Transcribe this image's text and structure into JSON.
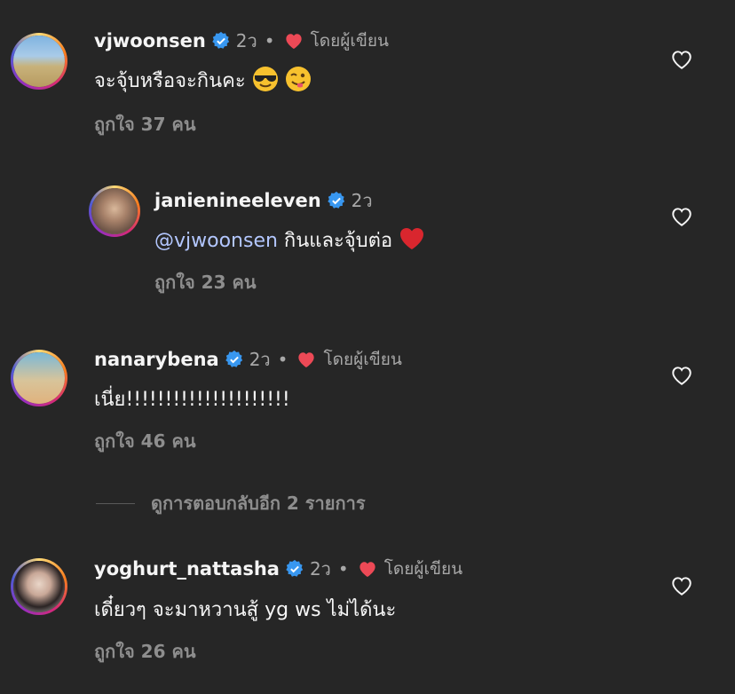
{
  "comments": [
    {
      "username": "vjwoonsen",
      "time": "2ว",
      "dot": "•",
      "author_label": "โดยผู้เขียน",
      "text": "จะจุ้บหรือจะกินคะ",
      "emojis": [
        "sunglasses-emoji",
        "winking-tongue-emoji"
      ],
      "likes": "ถูกใจ 37 คน"
    },
    {
      "username": "janienineeleven",
      "time": "2ว",
      "mention": "@vjwoonsen",
      "text": " กินและจุ้บต่อ",
      "emojis": [
        "red-heart-emoji"
      ],
      "likes": "ถูกใจ 23 คน"
    },
    {
      "username": "nanarybena",
      "time": "2ว",
      "dot": "•",
      "author_label": "โดยผู้เขียน",
      "text": "เนี่ย!!!!!!!!!!!!!!!!!!!!!",
      "likes": "ถูกใจ 46 คน"
    },
    {
      "username": "yoghurt_nattasha",
      "time": "2ว",
      "dot": "•",
      "author_label": "โดยผู้เขียน",
      "text": "เดี๋ยวๆ จะมาหวานสู้ yg ws ไม่ได้นะ",
      "likes": "ถูกใจ 26 คน"
    }
  ],
  "view_replies": "ดูการตอบกลับอีก 2 รายการ",
  "colors": {
    "background": "#262626",
    "verified": "#3897f0",
    "heart": "#ed4956",
    "muted": "#8e8e8e"
  }
}
